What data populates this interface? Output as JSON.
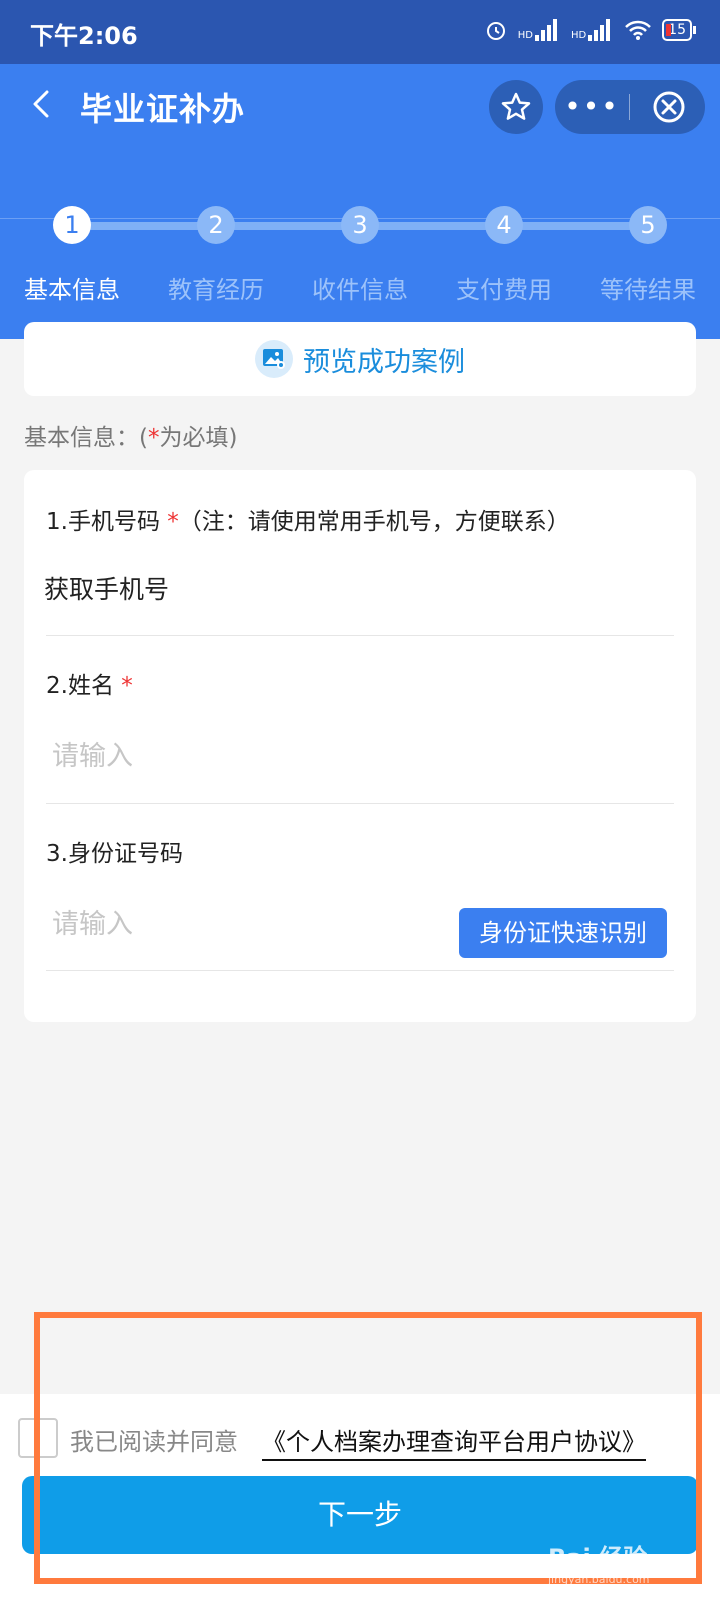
{
  "status_bar": {
    "time": "下午2:06",
    "network_label_1": "HD",
    "network_label_2": "HD",
    "battery": "15"
  },
  "header": {
    "title": "毕业证补办",
    "back_icon": "chevron-left-icon",
    "favorite_icon": "star-icon",
    "more_label": "•••",
    "close_icon": "close-circle-icon"
  },
  "steps": [
    {
      "number": "1",
      "label": "基本信息",
      "active": true
    },
    {
      "number": "2",
      "label": "教育经历",
      "active": false
    },
    {
      "number": "3",
      "label": "收件信息",
      "active": false
    },
    {
      "number": "4",
      "label": "支付费用",
      "active": false
    },
    {
      "number": "5",
      "label": "等待结果",
      "active": false
    }
  ],
  "preview": {
    "label": "预览成功案例",
    "icon": "image-preview-icon"
  },
  "section": {
    "prefix": "基本信息：(",
    "star": "*",
    "suffix": "为必填)"
  },
  "fields": {
    "phone": {
      "label": "1.手机号码",
      "required_mark": "*",
      "note": "（注：请使用常用手机号，方便联系）",
      "value": "获取手机号"
    },
    "name": {
      "label": "2.姓名",
      "required_mark": "*",
      "placeholder": "请输入"
    },
    "id_number": {
      "label": "3.身份证号码",
      "placeholder": "请输入",
      "button_label": "身份证快速识别"
    }
  },
  "agreement": {
    "text": "我已阅读并同意",
    "link": "《个人档案办理查询平台用户协议》"
  },
  "next_button": "下一步",
  "watermark": {
    "text": "Bai 经验",
    "url": "jingyan.baidu.com"
  },
  "colors": {
    "header_blue": "#3b7ff0",
    "status_bar": "#2b56b0",
    "next_button": "#0f9de8",
    "highlight": "#ff7a3d",
    "required": "#e33333"
  }
}
